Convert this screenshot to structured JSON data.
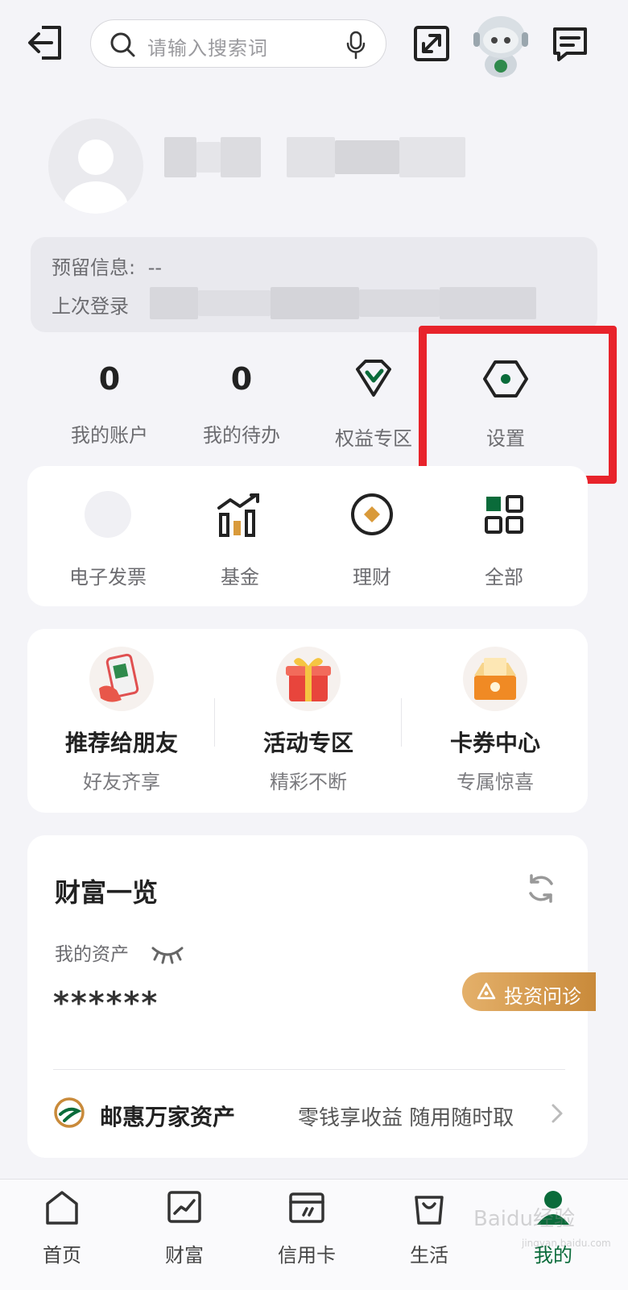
{
  "search": {
    "placeholder": "请输入搜索词"
  },
  "profile": {
    "reserved_info_label": "预留信息:",
    "reserved_info_value": "--",
    "last_login_label": "上次登录"
  },
  "stats": [
    {
      "value": "0",
      "label": "我的账户"
    },
    {
      "value": "0",
      "label": "我的待办"
    }
  ],
  "shortcuts": {
    "rights_label": "权益专区",
    "settings_label": "设置"
  },
  "services": [
    {
      "label": "电子发票",
      "icon": "invoice-icon"
    },
    {
      "label": "基金",
      "icon": "fund-chart-icon"
    },
    {
      "label": "理财",
      "icon": "wealth-coin-icon"
    },
    {
      "label": "全部",
      "icon": "grid-icon"
    }
  ],
  "promos": [
    {
      "title": "推荐给朋友",
      "subtitle": "好友齐享",
      "icon": "qr-phone-icon"
    },
    {
      "title": "活动专区",
      "subtitle": "精彩不断",
      "icon": "gift-icon"
    },
    {
      "title": "卡券中心",
      "subtitle": "专属惊喜",
      "icon": "coupon-box-icon"
    }
  ],
  "wealth": {
    "title": "财富一览",
    "asset_label": "我的资产",
    "asset_value": "******",
    "invest_badge": "投资问诊",
    "product_name": "邮惠万家资产",
    "product_desc": "零钱享收益 随用随时取"
  },
  "tabs": [
    {
      "label": "首页",
      "icon": "home-icon"
    },
    {
      "label": "财富",
      "icon": "wealth-trend-icon"
    },
    {
      "label": "信用卡",
      "icon": "credit-card-icon"
    },
    {
      "label": "生活",
      "icon": "shopping-bag-icon"
    },
    {
      "label": "我的",
      "icon": "person-icon",
      "active": true
    }
  ],
  "colors": {
    "brand_green": "#0a6b3a",
    "highlight_red": "#e8232b",
    "gold": "#c98a3a"
  },
  "watermark": {
    "text": "Baidu经验",
    "sub": "jingyan.baidu.com"
  }
}
